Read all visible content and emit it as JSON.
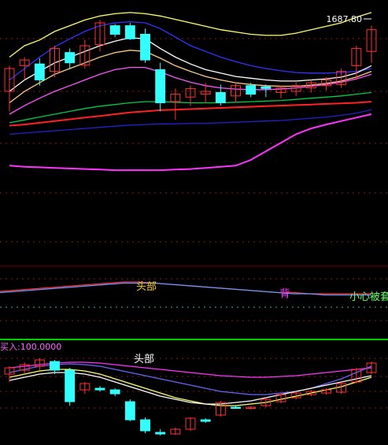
{
  "chart_data": [
    {
      "type": "candlestick",
      "title": "",
      "price_label": "1687.80",
      "candles": [
        {
          "o": 1580,
          "h": 1625,
          "l": 1545,
          "c": 1620
        },
        {
          "o": 1625,
          "h": 1640,
          "l": 1600,
          "c": 1635
        },
        {
          "o": 1628,
          "h": 1638,
          "l": 1590,
          "c": 1600
        },
        {
          "o": 1615,
          "h": 1660,
          "l": 1605,
          "c": 1655
        },
        {
          "o": 1648,
          "h": 1655,
          "l": 1620,
          "c": 1630
        },
        {
          "o": 1626,
          "h": 1670,
          "l": 1620,
          "c": 1660
        },
        {
          "o": 1662,
          "h": 1705,
          "l": 1650,
          "c": 1700
        },
        {
          "o": 1695,
          "h": 1698,
          "l": 1675,
          "c": 1680
        },
        {
          "o": 1695,
          "h": 1700,
          "l": 1670,
          "c": 1672
        },
        {
          "o": 1680,
          "h": 1690,
          "l": 1630,
          "c": 1635
        },
        {
          "o": 1618,
          "h": 1630,
          "l": 1545,
          "c": 1560
        },
        {
          "o": 1562,
          "h": 1585,
          "l": 1530,
          "c": 1575
        },
        {
          "o": 1570,
          "h": 1590,
          "l": 1555,
          "c": 1585
        },
        {
          "o": 1575,
          "h": 1595,
          "l": 1560,
          "c": 1580
        },
        {
          "o": 1578,
          "h": 1592,
          "l": 1555,
          "c": 1560
        },
        {
          "o": 1572,
          "h": 1596,
          "l": 1560,
          "c": 1590
        },
        {
          "o": 1590,
          "h": 1595,
          "l": 1570,
          "c": 1575
        },
        {
          "o": 1588,
          "h": 1592,
          "l": 1570,
          "c": 1585
        },
        {
          "o": 1578,
          "h": 1590,
          "l": 1568,
          "c": 1586
        },
        {
          "o": 1580,
          "h": 1596,
          "l": 1572,
          "c": 1590
        },
        {
          "o": 1586,
          "h": 1600,
          "l": 1578,
          "c": 1595
        },
        {
          "o": 1590,
          "h": 1605,
          "l": 1582,
          "c": 1600
        },
        {
          "o": 1592,
          "h": 1620,
          "l": 1586,
          "c": 1615
        },
        {
          "o": 1625,
          "h": 1660,
          "l": 1600,
          "c": 1655
        },
        {
          "o": 1650,
          "h": 1695,
          "l": 1630,
          "c": 1688
        }
      ],
      "series": [
        {
          "color": "#ffff66",
          "values": [
            1640,
            1660,
            1670,
            1685,
            1695,
            1705,
            1712,
            1716,
            1718,
            1716,
            1712,
            1706,
            1700,
            1694,
            1688,
            1684,
            1680,
            1678,
            1678,
            1682,
            1688,
            1694,
            1700,
            1710,
            1718
          ]
        },
        {
          "color": "#3333ff",
          "values": [
            1600,
            1620,
            1640,
            1658,
            1672,
            1685,
            1695,
            1700,
            1702,
            1700,
            1690,
            1675,
            1660,
            1650,
            1640,
            1632,
            1625,
            1620,
            1616,
            1613,
            1612,
            1612,
            1613,
            1615,
            1620
          ]
        },
        {
          "color": "#ffffff",
          "values": [
            1580,
            1600,
            1615,
            1630,
            1640,
            1650,
            1660,
            1668,
            1674,
            1672,
            1655,
            1640,
            1628,
            1618,
            1612,
            1606,
            1603,
            1600,
            1598,
            1598,
            1600,
            1602,
            1605,
            1612,
            1625
          ]
        },
        {
          "color": "#ffcc88",
          "values": [
            1560,
            1580,
            1595,
            1610,
            1620,
            1630,
            1640,
            1648,
            1652,
            1650,
            1638,
            1625,
            1615,
            1606,
            1600,
            1595,
            1592,
            1590,
            1589,
            1589,
            1591,
            1594,
            1598,
            1605,
            1615
          ]
        },
        {
          "color": "#ff55ff",
          "values": [
            1540,
            1555,
            1568,
            1580,
            1590,
            1600,
            1610,
            1618,
            1622,
            1622,
            1614,
            1604,
            1596,
            1590,
            1586,
            1584,
            1583,
            1583,
            1584,
            1586,
            1589,
            1592,
            1596,
            1602,
            1610
          ]
        },
        {
          "color": "#00cc44",
          "values": [
            1525,
            1530,
            1535,
            1540,
            1545,
            1550,
            1554,
            1557,
            1560,
            1562,
            1562,
            1561,
            1560,
            1560,
            1560,
            1561,
            1562,
            1563,
            1564,
            1566,
            1568,
            1570,
            1572,
            1575,
            1578
          ]
        },
        {
          "color": "#ff2222",
          "values": [
            1520,
            1522,
            1525,
            1528,
            1531,
            1534,
            1537,
            1540,
            1543,
            1545,
            1547,
            1548,
            1549,
            1550,
            1551,
            1552,
            1553,
            1554,
            1555,
            1556,
            1557,
            1558,
            1559,
            1560,
            1562
          ]
        },
        {
          "color": "#2222cc",
          "values": [
            1505,
            1507,
            1509,
            1511,
            1513,
            1515,
            1517,
            1519,
            1521,
            1522,
            1523,
            1523,
            1524,
            1524,
            1525,
            1526,
            1527,
            1528,
            1529,
            1531,
            1533,
            1535,
            1538,
            1542,
            1548
          ]
        },
        {
          "color": "#ff33ff",
          "values": [
            1450,
            1448,
            1447,
            1446,
            1445,
            1444,
            1443,
            1442,
            1442,
            1442,
            1442,
            1443,
            1444,
            1446,
            1448,
            1450,
            1460,
            1475,
            1490,
            1505,
            1515,
            1522,
            1528,
            1534,
            1540
          ]
        }
      ]
    },
    {
      "type": "line",
      "annotations": [
        "头部",
        "背",
        "小心被套"
      ],
      "series": [
        {
          "color": "#ff3333",
          "values": [
            50,
            51,
            52,
            53,
            54,
            55,
            56,
            57,
            58,
            58,
            57,
            56,
            55,
            54,
            53,
            52,
            51,
            50,
            49,
            49,
            48,
            48,
            48,
            48,
            48
          ]
        },
        {
          "color": "#6699ff",
          "values": [
            49,
            50,
            51,
            52,
            53,
            54,
            55,
            56,
            57,
            57,
            57,
            56,
            55,
            54,
            53,
            52,
            51,
            50,
            49,
            48,
            48,
            47,
            47,
            47,
            47
          ]
        }
      ]
    },
    {
      "type": "candlestick",
      "label": "买入:100.0000",
      "annotations": [
        "头部"
      ],
      "candles": [
        {
          "o": 80,
          "h": 90,
          "l": 70,
          "c": 88
        },
        {
          "o": 85,
          "h": 95,
          "l": 80,
          "c": 92
        },
        {
          "o": 90,
          "h": 100,
          "l": 85,
          "c": 98
        },
        {
          "o": 96,
          "h": 98,
          "l": 80,
          "c": 85
        },
        {
          "o": 85,
          "h": 88,
          "l": 40,
          "c": 45
        },
        {
          "o": 60,
          "h": 70,
          "l": 55,
          "c": 68
        },
        {
          "o": 62,
          "h": 65,
          "l": 58,
          "c": 60
        },
        {
          "o": 60,
          "h": 62,
          "l": 52,
          "c": 55
        },
        {
          "o": 45,
          "h": 48,
          "l": 20,
          "c": 22
        },
        {
          "o": 22,
          "h": 25,
          "l": 5,
          "c": 8
        },
        {
          "o": 6,
          "h": 10,
          "l": 2,
          "c": 4
        },
        {
          "o": 4,
          "h": 12,
          "l": 3,
          "c": 10
        },
        {
          "o": 10,
          "h": 25,
          "l": 8,
          "c": 24
        },
        {
          "o": 22,
          "h": 24,
          "l": 18,
          "c": 20
        },
        {
          "o": 28,
          "h": 46,
          "l": 26,
          "c": 44
        },
        {
          "o": 38,
          "h": 40,
          "l": 36,
          "c": 37
        },
        {
          "o": 37,
          "h": 39,
          "l": 35,
          "c": 38
        },
        {
          "o": 40,
          "h": 50,
          "l": 38,
          "c": 48
        },
        {
          "o": 45,
          "h": 56,
          "l": 43,
          "c": 54
        },
        {
          "o": 50,
          "h": 58,
          "l": 48,
          "c": 56
        },
        {
          "o": 54,
          "h": 60,
          "l": 52,
          "c": 58
        },
        {
          "o": 56,
          "h": 62,
          "l": 54,
          "c": 60
        },
        {
          "o": 57,
          "h": 70,
          "l": 55,
          "c": 68
        },
        {
          "o": 70,
          "h": 88,
          "l": 68,
          "c": 86
        },
        {
          "o": 82,
          "h": 96,
          "l": 80,
          "c": 94
        }
      ],
      "series": [
        {
          "color": "#ff33ff",
          "values": [
            88,
            90,
            92,
            94,
            95,
            95,
            94,
            92,
            90,
            88,
            86,
            84,
            82,
            80,
            78,
            77,
            76,
            76,
            77,
            78,
            80,
            82,
            84,
            86,
            88
          ]
        },
        {
          "color": "#6666ff",
          "values": [
            82,
            86,
            90,
            92,
            93,
            92,
            90,
            86,
            82,
            78,
            74,
            70,
            66,
            62,
            58,
            56,
            54,
            54,
            56,
            58,
            62,
            68,
            74,
            82,
            90
          ]
        },
        {
          "color": "#ffff66",
          "values": [
            76,
            80,
            84,
            86,
            86,
            84,
            80,
            74,
            68,
            62,
            56,
            50,
            46,
            42,
            40,
            40,
            42,
            44,
            48,
            52,
            56,
            60,
            64,
            70,
            76
          ]
        },
        {
          "color": "#ffffff",
          "values": [
            72,
            76,
            80,
            82,
            82,
            80,
            76,
            70,
            64,
            58,
            52,
            48,
            44,
            42,
            42,
            44,
            46,
            50,
            54,
            58,
            62,
            66,
            70,
            74,
            78
          ]
        }
      ]
    }
  ]
}
